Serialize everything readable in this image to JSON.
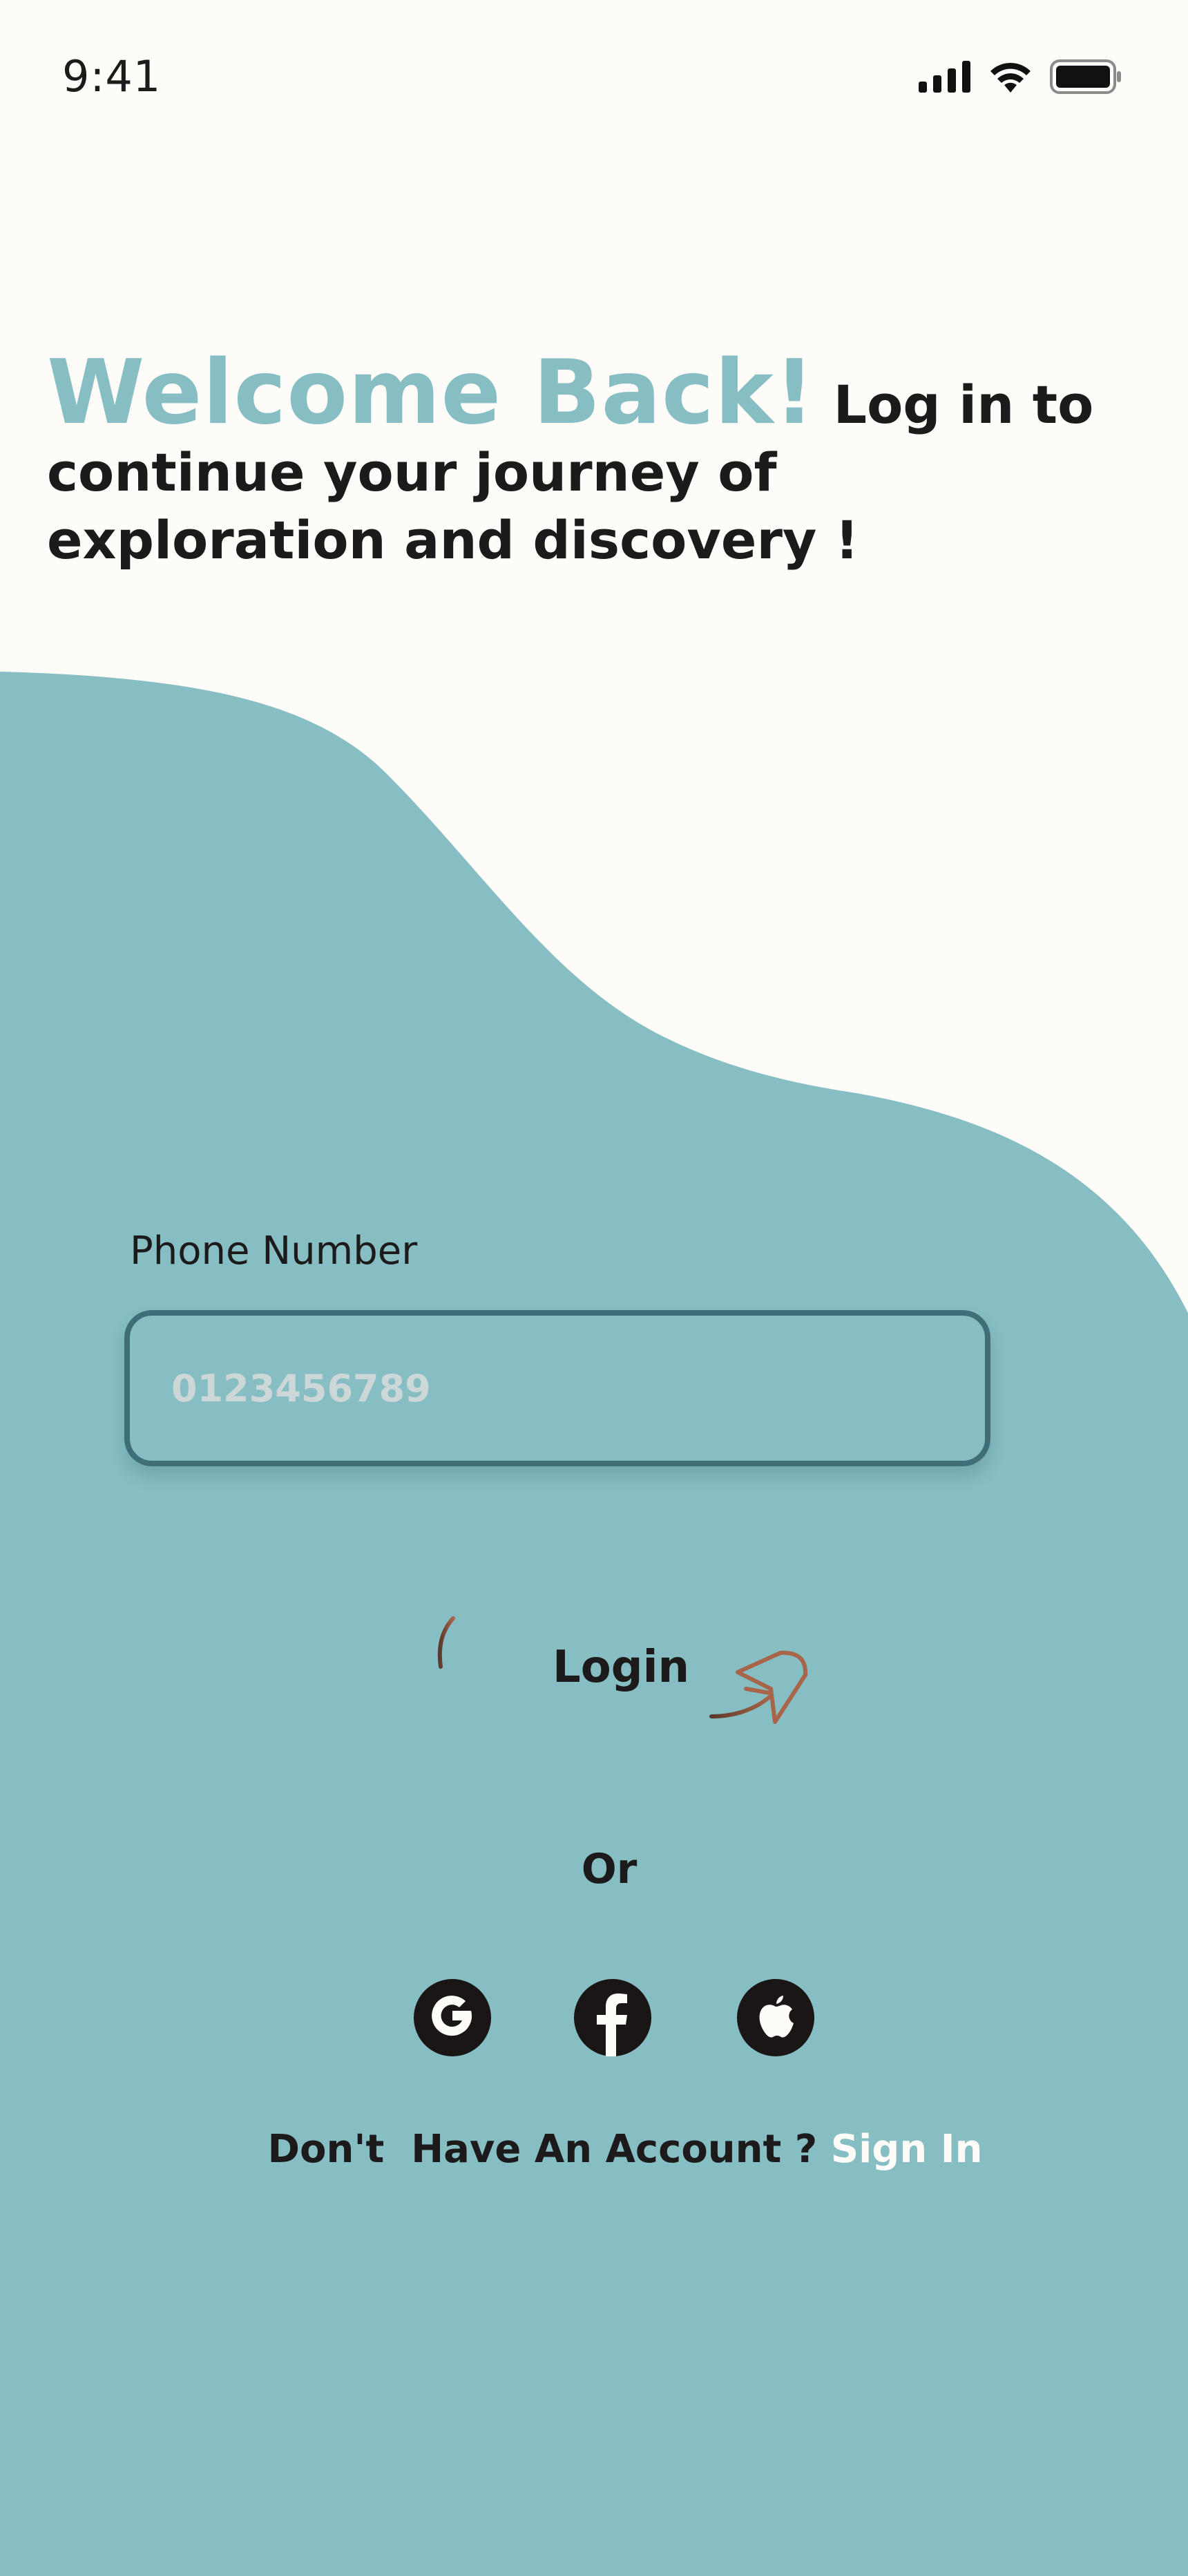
{
  "status_bar": {
    "time": "9:41",
    "icons": [
      "cellular-signal-icon",
      "wifi-icon",
      "battery-icon"
    ]
  },
  "intro": {
    "welcome": "Welcome Back!",
    "message": " Log in to continue your journey of exploration and discovery !"
  },
  "form": {
    "phone_label": "Phone Number",
    "phone_placeholder": "0123456789",
    "phone_value": ""
  },
  "actions": {
    "login_label": "Login",
    "or_label": "Or"
  },
  "social": {
    "providers": [
      "google-icon",
      "facebook-icon",
      "apple-icon"
    ]
  },
  "footer": {
    "prompt": "Don't  Have An Account ? ",
    "sign_in_label": "Sign In"
  },
  "colors": {
    "background": "#fdfcf8",
    "teal": "#86bec4",
    "input_border": "#3f6d78",
    "text_dark": "#1c1a1a",
    "login_outline": "#8a5a44"
  }
}
